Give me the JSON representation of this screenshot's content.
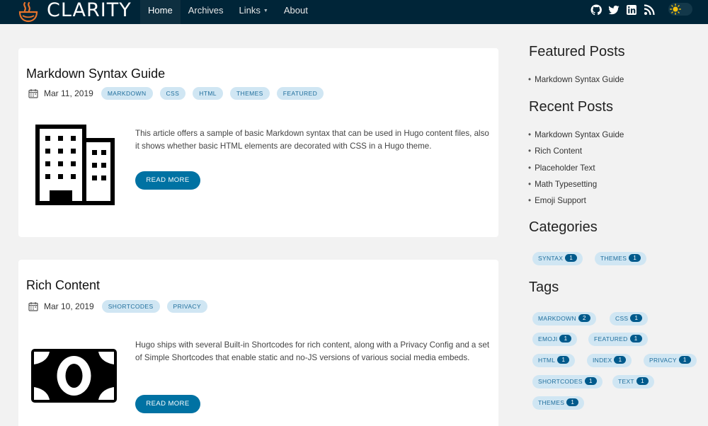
{
  "brand": {
    "name": "CLARITY"
  },
  "nav": {
    "items": [
      {
        "label": "Home",
        "active": true
      },
      {
        "label": "Archives"
      },
      {
        "label": "Links",
        "dropdown": true
      },
      {
        "label": "About"
      }
    ],
    "social_icons": [
      "github-icon",
      "twitter-icon",
      "linkedin-icon",
      "rss-icon"
    ],
    "theme_toggle_icon": "sun-icon"
  },
  "posts": [
    {
      "title": "Markdown Syntax Guide",
      "date": "Mar 11, 2019",
      "tags": [
        "MARKDOWN",
        "CSS",
        "HTML",
        "THEMES",
        "FEATURED"
      ],
      "thumbnail_icon": "building-icon",
      "excerpt": "This article offers a sample of basic Markdown syntax that can be used in Hugo content files, also it shows whether basic HTML elements are decorated with CSS in a Hugo theme.",
      "button": "READ MORE"
    },
    {
      "title": "Rich Content",
      "date": "Mar 10, 2019",
      "tags": [
        "SHORTCODES",
        "PRIVACY"
      ],
      "thumbnail_icon": "banknote-icon",
      "excerpt": "Hugo ships with several Built-in Shortcodes for rich content, along with a Privacy Config and a set of Simple Shortcodes that enable static and no-JS versions of various social media embeds.",
      "button": "READ MORE"
    }
  ],
  "sidebar": {
    "featured": {
      "heading": "Featured Posts",
      "items": [
        "Markdown Syntax Guide"
      ]
    },
    "recent": {
      "heading": "Recent Posts",
      "items": [
        "Markdown Syntax Guide",
        "Rich Content",
        "Placeholder Text",
        "Math Typesetting",
        "Emoji Support"
      ]
    },
    "categories": {
      "heading": "Categories",
      "items": [
        {
          "label": "SYNTAX",
          "count": "1"
        },
        {
          "label": "THEMES",
          "count": "1"
        }
      ]
    },
    "tags": {
      "heading": "Tags",
      "items": [
        {
          "label": "MARKDOWN",
          "count": "2"
        },
        {
          "label": "CSS",
          "count": "1"
        },
        {
          "label": "EMOJI",
          "count": "1"
        },
        {
          "label": "FEATURED",
          "count": "1"
        },
        {
          "label": "HTML",
          "count": "1"
        },
        {
          "label": "INDEX",
          "count": "1"
        },
        {
          "label": "PRIVACY",
          "count": "1"
        },
        {
          "label": "SHORTCODES",
          "count": "1"
        },
        {
          "label": "TEXT",
          "count": "1"
        },
        {
          "label": "THEMES",
          "count": "1"
        }
      ]
    }
  },
  "colors": {
    "navbar": "#002538",
    "accent": "#0072a3",
    "tag_bg": "#d0e6f3",
    "tag_text": "#1f6e9c",
    "page_bg": "#f2f2f2"
  }
}
